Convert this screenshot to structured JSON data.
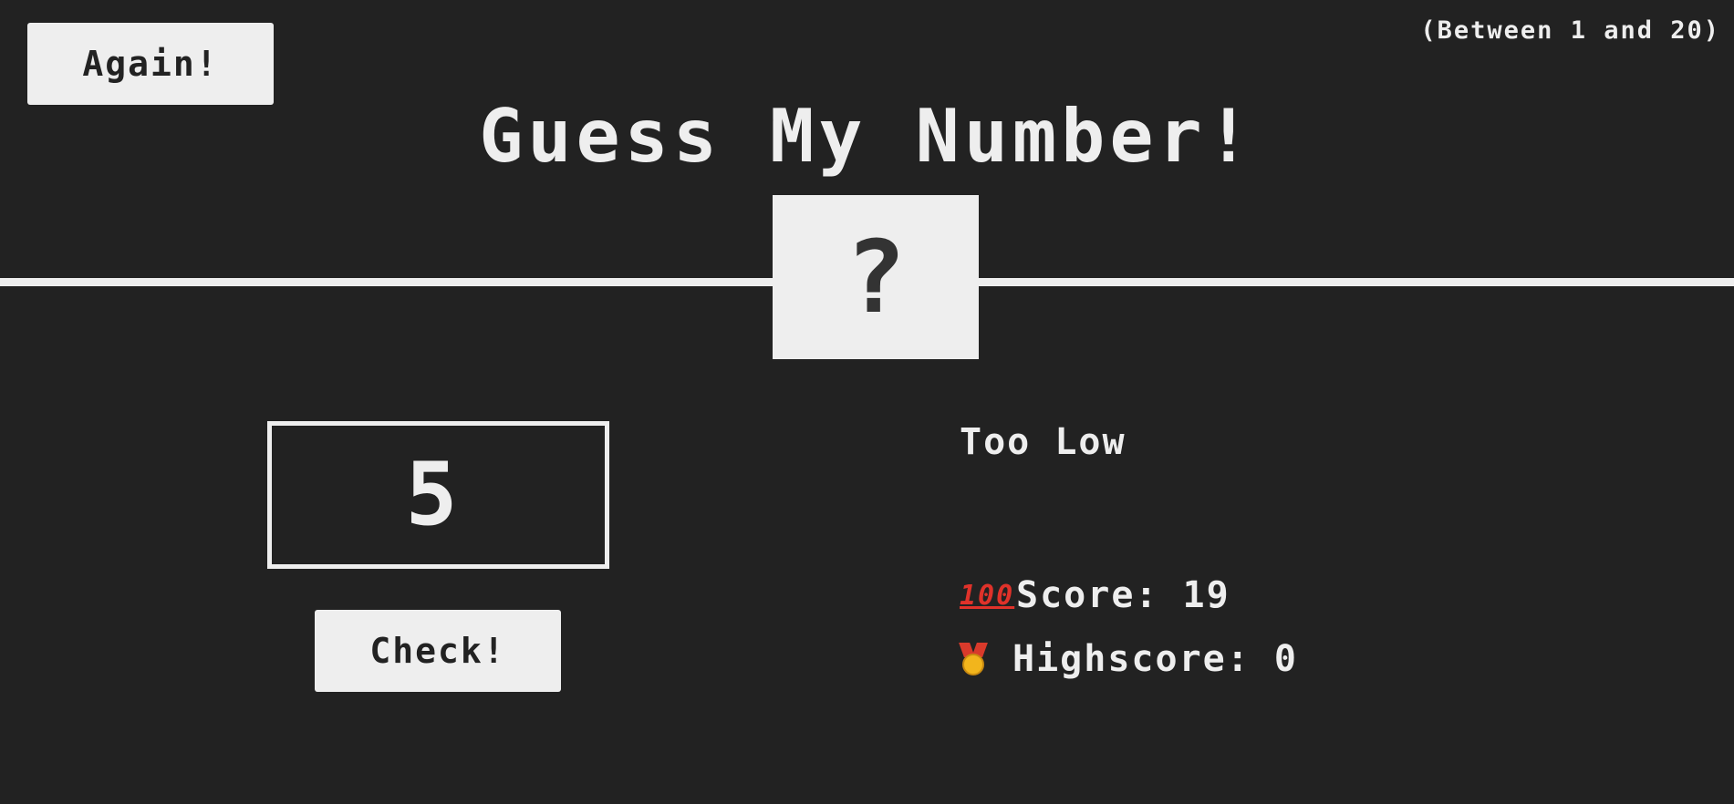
{
  "header": {
    "again_label": "Again!",
    "range_hint": "(Between 1 and 20)",
    "title": "Guess My Number!"
  },
  "secret": {
    "display": "?"
  },
  "guess": {
    "value": "5"
  },
  "controls": {
    "check_label": "Check!"
  },
  "status": {
    "message": "Too Low",
    "score_label": "Score:",
    "score_value": "19",
    "highscore_label": "Highscore:",
    "highscore_value": "0",
    "score_icon": "hundred-points-icon",
    "highscore_icon": "medal-icon"
  },
  "colors": {
    "background": "#222222",
    "foreground": "#eeeeee"
  }
}
